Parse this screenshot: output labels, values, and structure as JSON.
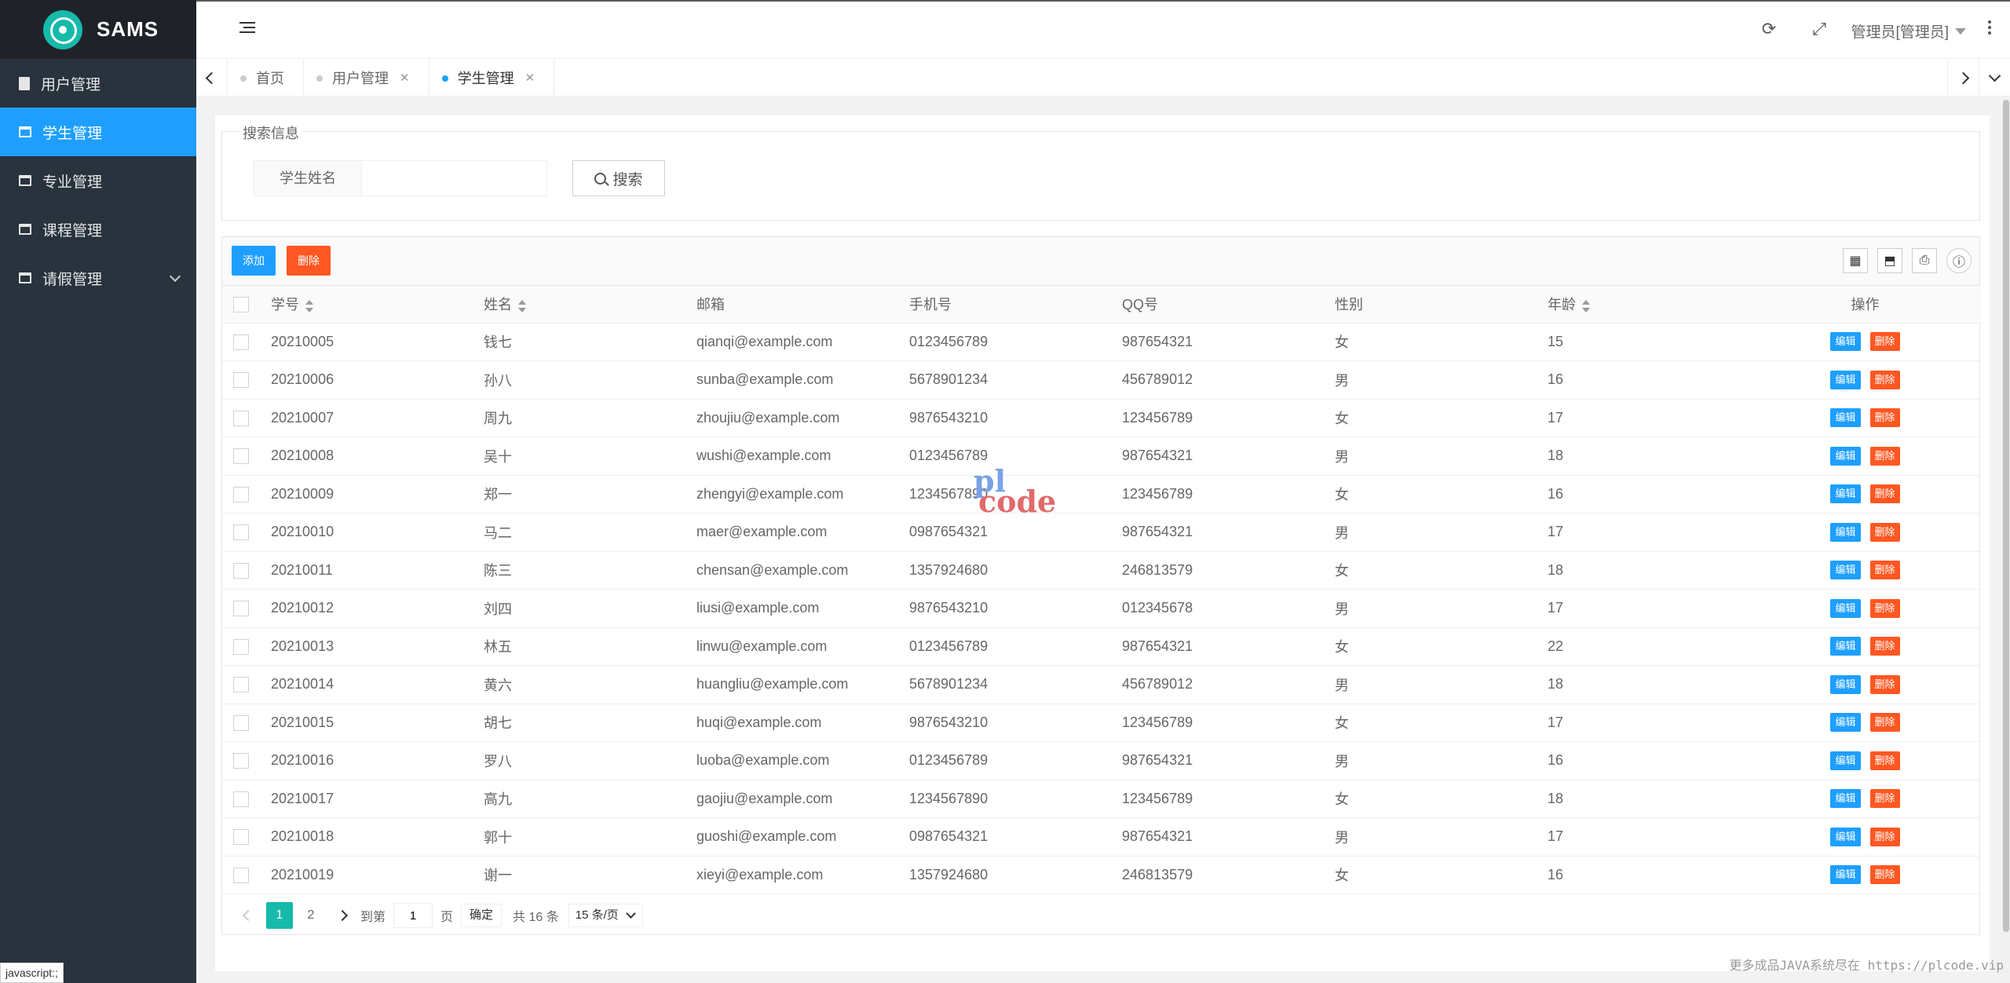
{
  "app": {
    "title": "SAMS"
  },
  "sidebar": {
    "items": [
      {
        "label": "用户管理"
      },
      {
        "label": "学生管理"
      },
      {
        "label": "专业管理"
      },
      {
        "label": "课程管理"
      },
      {
        "label": "请假管理"
      }
    ]
  },
  "header": {
    "user": "管理员[管理员]"
  },
  "tabs": [
    {
      "label": "首页"
    },
    {
      "label": "用户管理",
      "close": "✕"
    },
    {
      "label": "学生管理",
      "close": "✕"
    }
  ],
  "search": {
    "legend": "搜索信息",
    "label": "学生姓名",
    "value": "",
    "button": "搜索"
  },
  "toolbar": {
    "add": "添加",
    "delete": "删除"
  },
  "table": {
    "headers": [
      "学号",
      "姓名",
      "邮箱",
      "手机号",
      "QQ号",
      "性别",
      "年龄",
      "操作"
    ],
    "edit": "编辑",
    "remove": "删除",
    "rows": [
      [
        "20210005",
        "钱七",
        "qianqi@example.com",
        "0123456789",
        "987654321",
        "女",
        "15"
      ],
      [
        "20210006",
        "孙八",
        "sunba@example.com",
        "5678901234",
        "456789012",
        "男",
        "16"
      ],
      [
        "20210007",
        "周九",
        "zhoujiu@example.com",
        "9876543210",
        "123456789",
        "女",
        "17"
      ],
      [
        "20210008",
        "吴十",
        "wushi@example.com",
        "0123456789",
        "987654321",
        "男",
        "18"
      ],
      [
        "20210009",
        "郑一",
        "zhengyi@example.com",
        "1234567890",
        "123456789",
        "女",
        "16"
      ],
      [
        "20210010",
        "马二",
        "maer@example.com",
        "0987654321",
        "987654321",
        "男",
        "17"
      ],
      [
        "20210011",
        "陈三",
        "chensan@example.com",
        "1357924680",
        "246813579",
        "女",
        "18"
      ],
      [
        "20210012",
        "刘四",
        "liusi@example.com",
        "9876543210",
        "012345678",
        "男",
        "17"
      ],
      [
        "20210013",
        "林五",
        "linwu@example.com",
        "0123456789",
        "987654321",
        "女",
        "22"
      ],
      [
        "20210014",
        "黄六",
        "huangliu@example.com",
        "5678901234",
        "456789012",
        "男",
        "18"
      ],
      [
        "20210015",
        "胡七",
        "huqi@example.com",
        "9876543210",
        "123456789",
        "女",
        "17"
      ],
      [
        "20210016",
        "罗八",
        "luoba@example.com",
        "0123456789",
        "987654321",
        "男",
        "16"
      ],
      [
        "20210017",
        "高九",
        "gaojiu@example.com",
        "1234567890",
        "123456789",
        "女",
        "18"
      ],
      [
        "20210018",
        "郭十",
        "guoshi@example.com",
        "0987654321",
        "987654321",
        "男",
        "17"
      ],
      [
        "20210019",
        "谢一",
        "xieyi@example.com",
        "1357924680",
        "246813579",
        "女",
        "16"
      ]
    ]
  },
  "pager": {
    "pages": [
      "1",
      "2"
    ],
    "goto_label": "到第",
    "page_value": "1",
    "page_unit": "页",
    "confirm": "确定",
    "total": "共 16 条",
    "page_size": "15 条/页"
  },
  "watermark": {
    "line1": "pl",
    "line2": "code"
  },
  "footer_note": "更多成品JAVA系统尽在 https://plcode.vip",
  "status_bar": "javascript:;",
  "colors": {
    "primary": "#1e9fff",
    "danger": "#ff5722",
    "sidebar": "#28333e",
    "teal": "#16baaa"
  }
}
